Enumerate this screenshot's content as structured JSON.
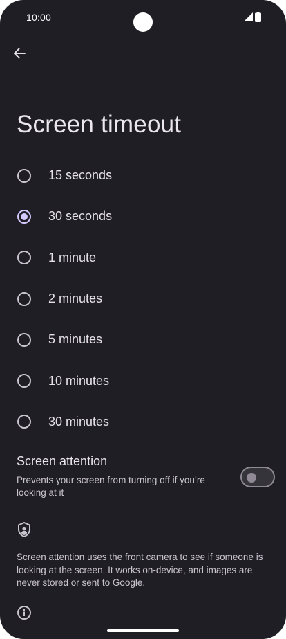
{
  "status_bar": {
    "time": "10:00"
  },
  "header": {
    "title": "Screen timeout"
  },
  "timeout_options": [
    {
      "label": "15 seconds",
      "selected": false
    },
    {
      "label": "30 seconds",
      "selected": true
    },
    {
      "label": "1 minute",
      "selected": false
    },
    {
      "label": "2 minutes",
      "selected": false
    },
    {
      "label": "5 minutes",
      "selected": false
    },
    {
      "label": "10 minutes",
      "selected": false
    },
    {
      "label": "30 minutes",
      "selected": false
    }
  ],
  "screen_attention": {
    "title": "Screen attention",
    "subtitle": "Prevents your screen from turning off if you’re looking at it",
    "enabled": false
  },
  "privacy": {
    "description": "Screen attention uses the front camera to see if someone is looking at the screen. It works on-device, and images are never stored or sent to Google."
  },
  "colors": {
    "background": "#1f1e24",
    "accent": "#d3c9ff",
    "text": "#e6e1e9"
  }
}
